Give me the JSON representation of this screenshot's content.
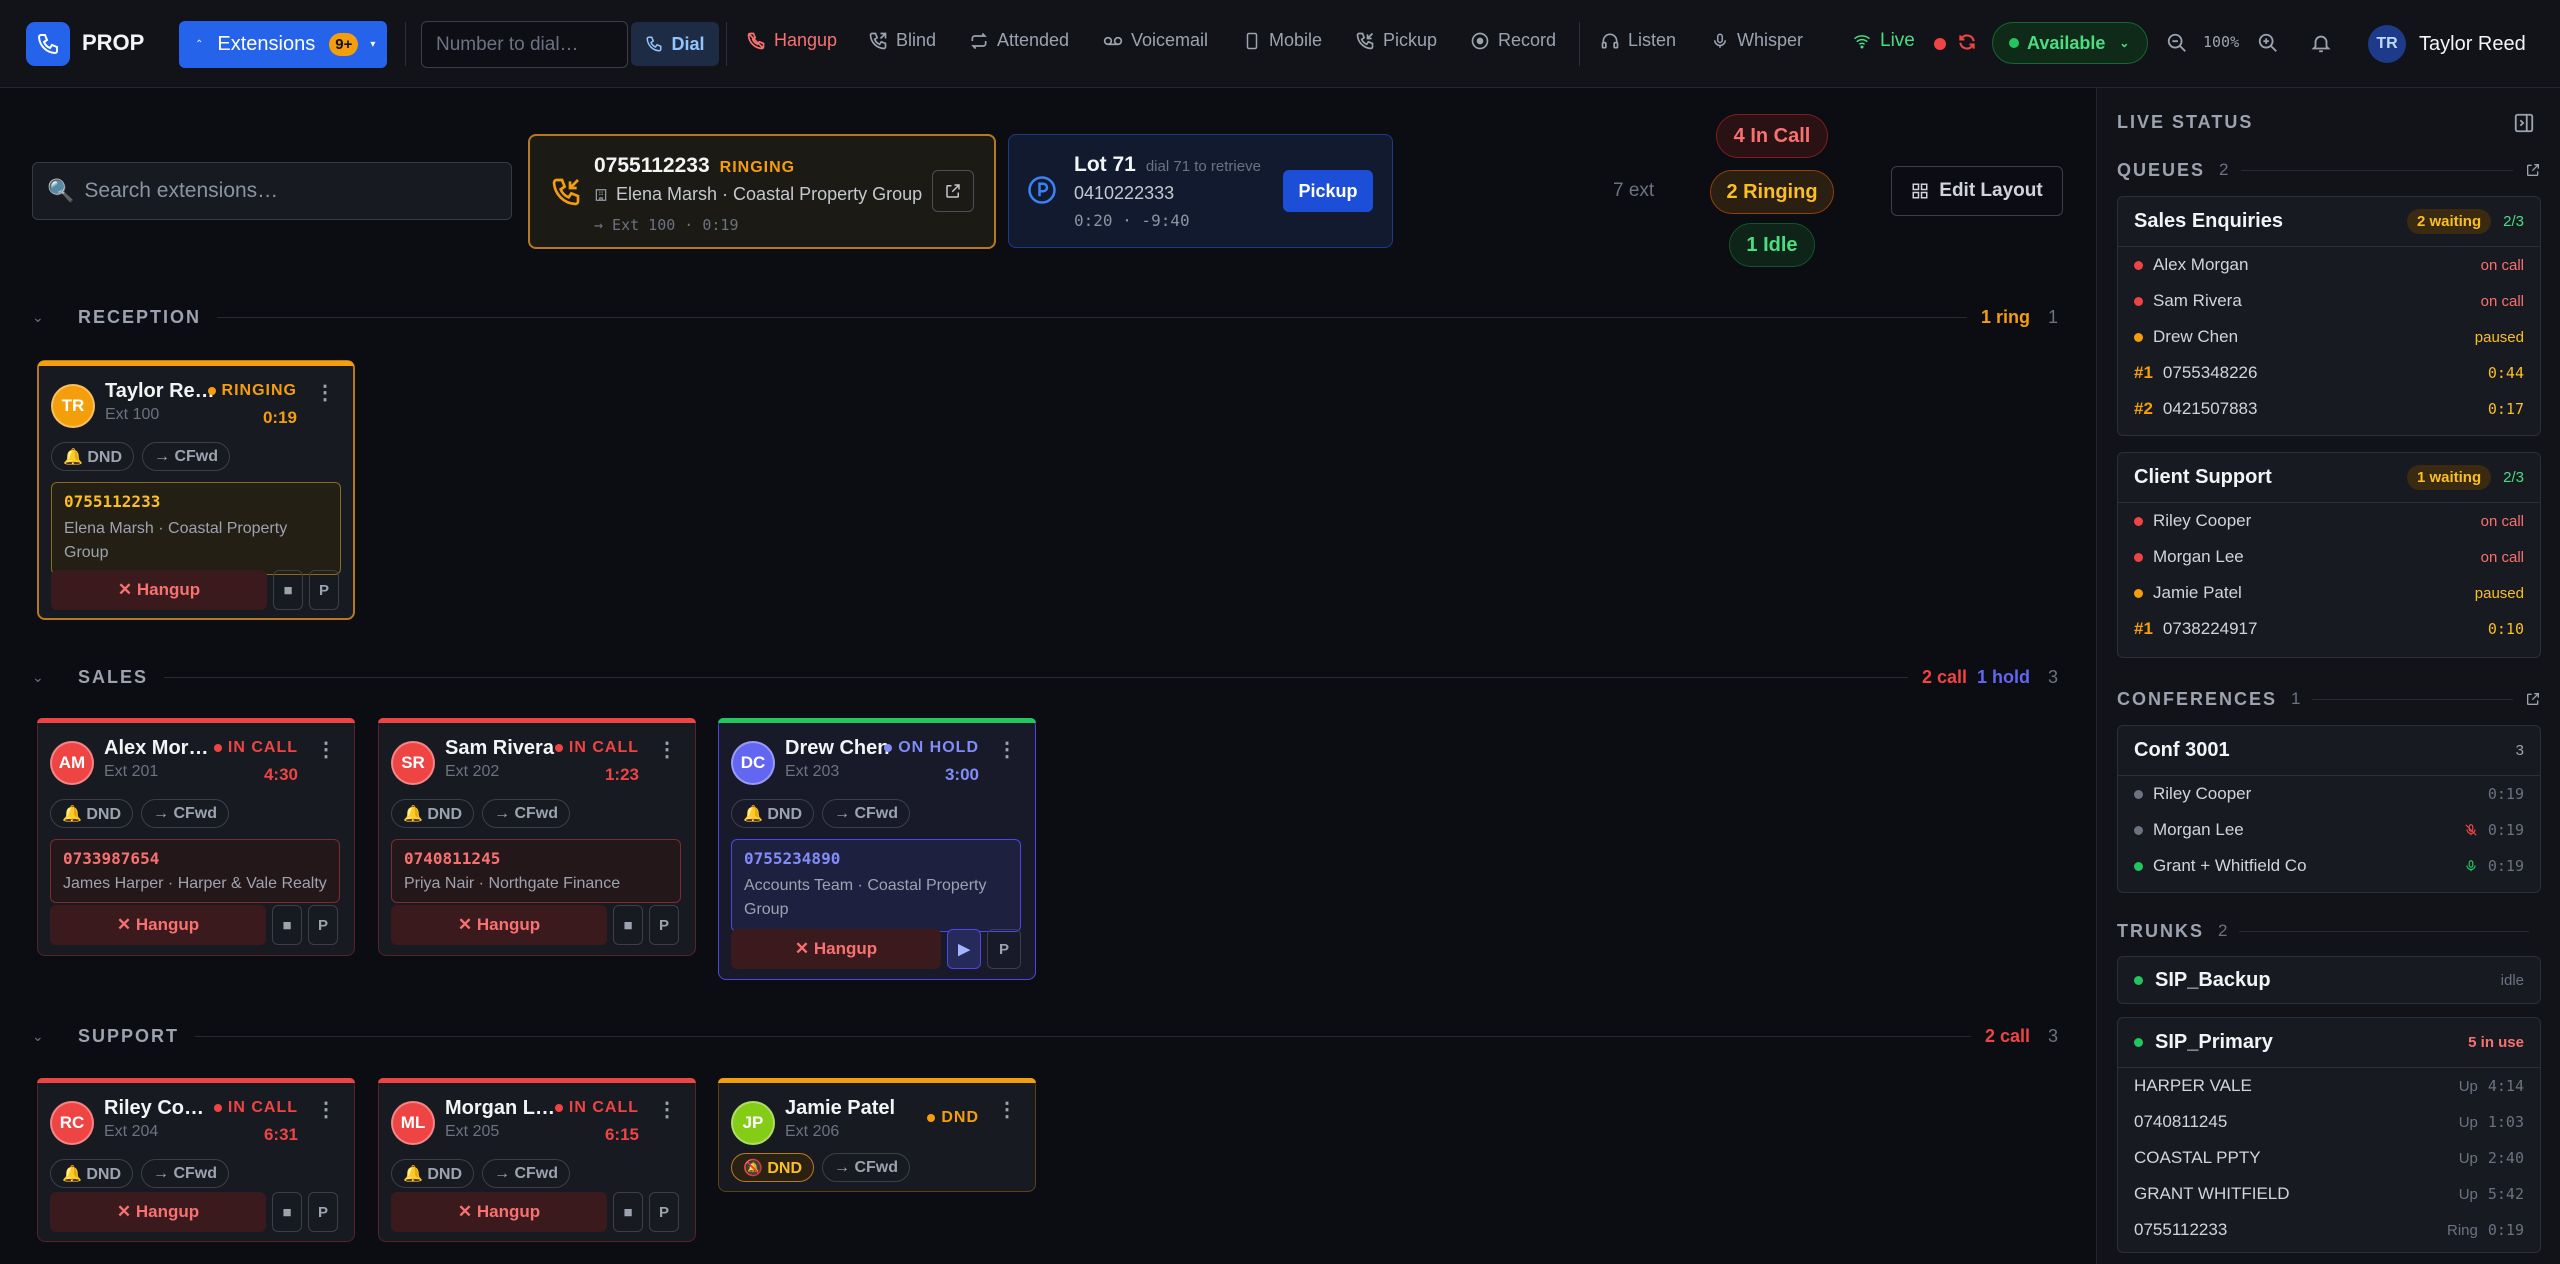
{
  "app": {
    "brand": "PROP"
  },
  "topbar": {
    "extensions_label": "Extensions",
    "extensions_badge": "9+",
    "dial_placeholder": "Number to dial…",
    "dial_label": "Dial",
    "hangup": "Hangup",
    "blind": "Blind",
    "attended": "Attended",
    "voicemail": "Voicemail",
    "mobile": "Mobile",
    "pickup": "Pickup",
    "record": "Record",
    "listen": "Listen",
    "whisper": "Whisper",
    "live": "Live",
    "status": "Available",
    "zoom": "100%",
    "user_initials": "TR",
    "user_name": "Taylor Reed"
  },
  "search": {
    "placeholder": "Search extensions…"
  },
  "ringing_call": {
    "number": "0755112233",
    "state": "RINGING",
    "caller": "Elena Marsh · Coastal Property Group",
    "detail": "→ Ext 100 · 0:19"
  },
  "parked": {
    "lot": "Lot 71",
    "hint": "dial 71 to retrieve",
    "number": "0410222333",
    "timer": "0:20 · -9:40",
    "action": "Pickup"
  },
  "summary": {
    "ext_count": "7 ext",
    "in_call": "4 In Call",
    "ringing": "2 Ringing",
    "idle": "1 Idle",
    "edit_layout": "Edit Layout"
  },
  "groups": [
    {
      "title": "RECEPTION",
      "stat1": "1 ring",
      "stat2": "",
      "count": "1"
    },
    {
      "title": "SALES",
      "stat1": "2 call",
      "stat2": "1 hold",
      "count": "3"
    },
    {
      "title": "SUPPORT",
      "stat1": "2 call",
      "stat2": "",
      "count": "3"
    }
  ],
  "cards": [
    {
      "initials": "TR",
      "name": "Taylor Reed",
      "ext": "Ext 100",
      "state": "RINGING",
      "time": "0:19",
      "dnd": "🔔 DND",
      "cfwd": "→ CFwd",
      "number": "0755112233",
      "contact": "Elena Marsh · Coastal Property Group",
      "hangup": "✕ Hangup",
      "hold": "■",
      "park": "P"
    },
    {
      "initials": "AM",
      "name": "Alex Morgan",
      "ext": "Ext 201",
      "state": "IN CALL",
      "time": "4:30",
      "dnd": "🔔 DND",
      "cfwd": "→ CFwd",
      "number": "0733987654",
      "contact": "James Harper · Harper & Vale Realty",
      "hangup": "✕ Hangup",
      "hold": "■",
      "park": "P"
    },
    {
      "initials": "SR",
      "name": "Sam Rivera",
      "ext": "Ext 202",
      "state": "IN CALL",
      "time": "1:23",
      "dnd": "🔔 DND",
      "cfwd": "→ CFwd",
      "number": "0740811245",
      "contact": "Priya Nair · Northgate Finance",
      "hangup": "✕ Hangup",
      "hold": "■",
      "park": "P"
    },
    {
      "initials": "DC",
      "name": "Drew Chen",
      "ext": "Ext 203",
      "state": "ON HOLD",
      "time": "3:00",
      "dnd": "🔔 DND",
      "cfwd": "→ CFwd",
      "number": "0755234890",
      "contact": "Accounts Team · Coastal Property Group",
      "hangup": "✕ Hangup",
      "hold": "▶",
      "park": "P"
    },
    {
      "initials": "RC",
      "name": "Riley Cooper",
      "ext": "Ext 204",
      "state": "IN CALL",
      "time": "6:31",
      "dnd": "🔔 DND",
      "cfwd": "→ CFwd",
      "hangup": "✕ Hangup",
      "hold": "■",
      "park": "P"
    },
    {
      "initials": "ML",
      "name": "Morgan Lee",
      "ext": "Ext 205",
      "state": "IN CALL",
      "time": "6:15",
      "dnd": "🔔 DND",
      "cfwd": "→ CFwd",
      "hangup": "✕ Hangup",
      "hold": "■",
      "park": "P"
    },
    {
      "initials": "JP",
      "name": "Jamie Patel",
      "ext": "Ext 206",
      "state": "DND",
      "dnd": "🔕 DND",
      "cfwd": "→ CFwd"
    }
  ],
  "colors": {
    "accent": "#2563eb",
    "in_call": "#ef4444",
    "ringing": "#f59e0b",
    "hold": "#6366f1",
    "idle": "#22c55e"
  },
  "live_status": {
    "title": "LIVE STATUS",
    "queues_title": "QUEUES",
    "queues_count": "2",
    "queues": [
      {
        "name": "Sales Enquiries",
        "waiting": "2 waiting",
        "ratio": "2/3",
        "members": [
          {
            "name": "Alex Morgan",
            "status": "on call"
          },
          {
            "name": "Sam Rivera",
            "status": "on call"
          },
          {
            "name": "Drew Chen",
            "status": "paused"
          }
        ],
        "callers": [
          {
            "pos": "#1",
            "number": "0755348226",
            "wait": "0:44"
          },
          {
            "pos": "#2",
            "number": "0421507883",
            "wait": "0:17"
          }
        ]
      },
      {
        "name": "Client Support",
        "waiting": "1 waiting",
        "ratio": "2/3",
        "members": [
          {
            "name": "Riley Cooper",
            "status": "on call"
          },
          {
            "name": "Morgan Lee",
            "status": "on call"
          },
          {
            "name": "Jamie Patel",
            "status": "paused"
          }
        ],
        "callers": [
          {
            "pos": "#1",
            "number": "0738224917",
            "wait": "0:10"
          }
        ]
      }
    ],
    "conf_title": "CONFERENCES",
    "conf_count": "1",
    "conference": {
      "name": "Conf 3001",
      "count": "3",
      "members": [
        {
          "name": "Riley Cooper",
          "time": "0:19"
        },
        {
          "name": "Morgan Lee",
          "time": "0:19"
        },
        {
          "name": "Grant + Whitfield Co",
          "time": "0:19"
        }
      ]
    },
    "trunks_title": "TRUNKS",
    "trunks_count": "2",
    "trunks": [
      {
        "name": "SIP_Backup",
        "state": "idle"
      },
      {
        "name": "SIP_Primary",
        "state": "5 in use",
        "channels": [
          {
            "label": "HARPER VALE",
            "state": "Up",
            "time": "4:14"
          },
          {
            "label": "0740811245",
            "state": "Up",
            "time": "1:03"
          },
          {
            "label": "COASTAL PPTY",
            "state": "Up",
            "time": "2:40"
          },
          {
            "label": "GRANT WHITFIELD",
            "state": "Up",
            "time": "5:42"
          },
          {
            "label": "0755112233",
            "state": "Ring",
            "time": "0:19"
          }
        ]
      }
    ]
  }
}
